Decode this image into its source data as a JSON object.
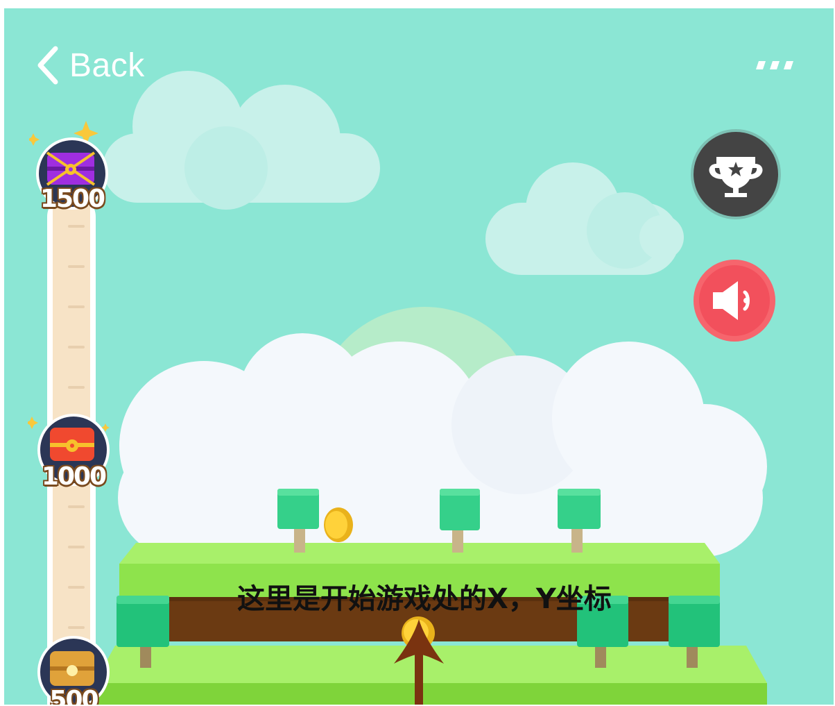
{
  "nav": {
    "back_label": "Back",
    "back_icon": "chevron-left-icon",
    "more_icon": "more-dots-icon"
  },
  "buttons": {
    "trophy_icon": "trophy-icon",
    "sound_icon": "speaker-icon"
  },
  "milestones": [
    {
      "score": "1500",
      "icon": "purple-chest-icon"
    },
    {
      "score": "1000",
      "icon": "red-chest-icon"
    },
    {
      "score": "500",
      "icon": "gold-chest-icon"
    }
  ],
  "annotation": {
    "text": "这里是开始游戏处的X，Y坐标",
    "arrow_icon": "up-arrow-icon"
  },
  "colors": {
    "sky": "#8be6d4",
    "trophy_button": "#444444",
    "sound_button": "#f2505c",
    "grass": "#8ee34c",
    "dirt": "#6b3a12",
    "arrow": "#7a3310"
  }
}
